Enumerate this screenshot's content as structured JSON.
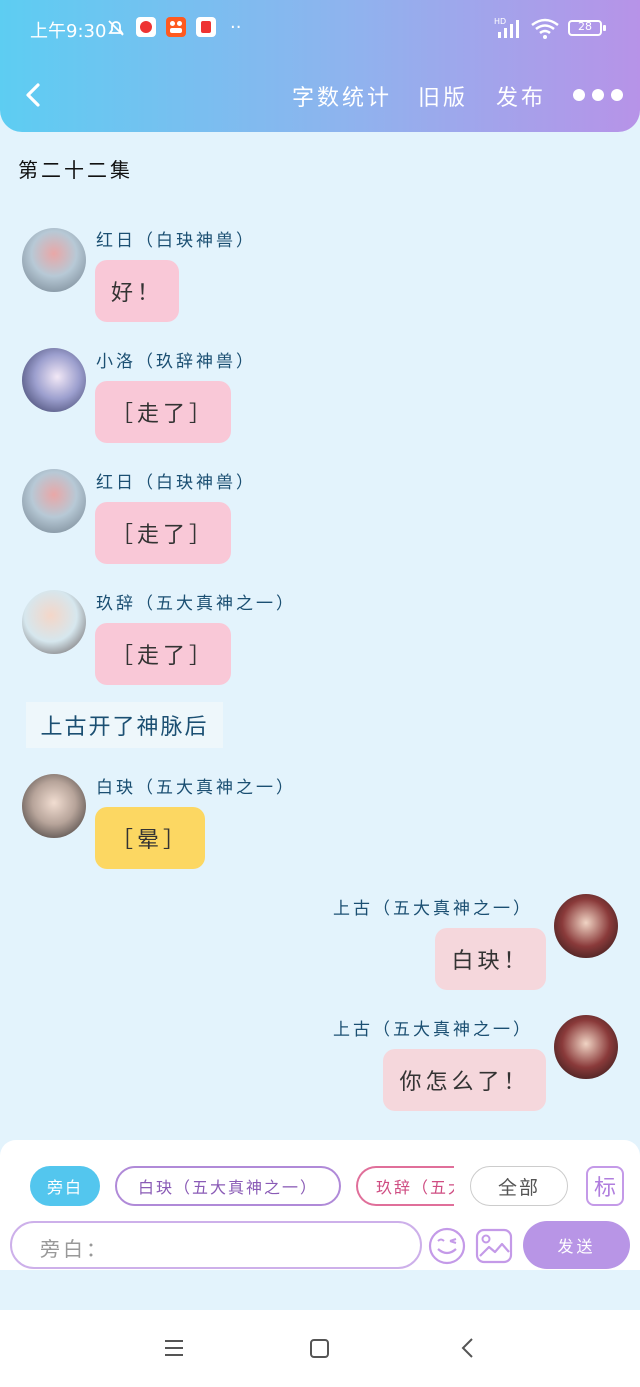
{
  "status_bar": {
    "time": "上午9:30",
    "battery": "28",
    "more": "··"
  },
  "header": {
    "back_icon": "chevron-left-icon",
    "word_count": "字数统计",
    "old_version": "旧版",
    "publish": "发布",
    "more_icon": "more-dots-icon"
  },
  "episode_title": "第二十二集",
  "messages": [
    {
      "name": "红日（白玦神兽）",
      "text": "好！"
    },
    {
      "name": "小洛（玖辞神兽）",
      "text": "［走了］"
    },
    {
      "name": "红日（白玦神兽）",
      "text": "［走了］"
    },
    {
      "name": "玖辞（五大真神之一）",
      "text": "［走了］"
    },
    {
      "narration": "上古开了神脉后"
    },
    {
      "name": "白玦（五大真神之一）",
      "text": "［晕］"
    },
    {
      "name": "上古（五大真神之一）",
      "text": "白玦！"
    },
    {
      "name": "上古（五大真神之一）",
      "text": "你怎么了！"
    }
  ],
  "composer": {
    "roles": [
      "旁白",
      "白玦（五大真神之一）",
      "玖辞（五大真神之一）"
    ],
    "all": "全部",
    "mark": "标",
    "placeholder": "旁白：",
    "send": "发送"
  },
  "colors": {
    "header_gradient": [
      "#5dcdf2",
      "#b793e8"
    ],
    "background": "#e3f3fc",
    "bubble_pink": "#f9c8d7",
    "bubble_yellow": "#fcd762",
    "bubble_rose": "#f5d7dc",
    "send_button": "#b895e6"
  }
}
